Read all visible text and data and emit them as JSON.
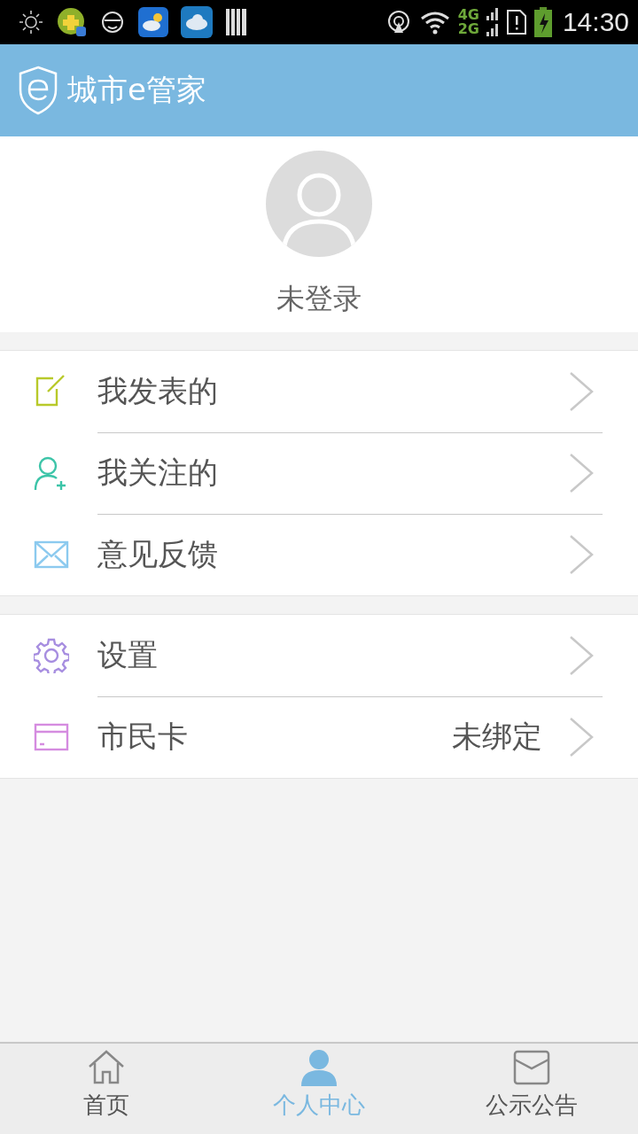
{
  "status_bar": {
    "network_top": "4G",
    "network_bottom": "2G",
    "time": "14:30"
  },
  "header": {
    "title": "城市e管家"
  },
  "profile": {
    "name": "未登录"
  },
  "menu_groups": [
    {
      "items": [
        {
          "kind": "edit",
          "label": "我发表的"
        },
        {
          "kind": "follow",
          "label": "我关注的"
        },
        {
          "kind": "mail",
          "label": "意见反馈"
        }
      ]
    },
    {
      "items": [
        {
          "kind": "gear",
          "label": "设置"
        },
        {
          "kind": "card",
          "label": "市民卡",
          "value": "未绑定"
        }
      ]
    }
  ],
  "bottom_nav": [
    {
      "kind": "home",
      "label": "首页",
      "selected": false
    },
    {
      "kind": "person",
      "label": "个人中心",
      "selected": true
    },
    {
      "kind": "mail",
      "label": "公示公告",
      "selected": false
    }
  ]
}
